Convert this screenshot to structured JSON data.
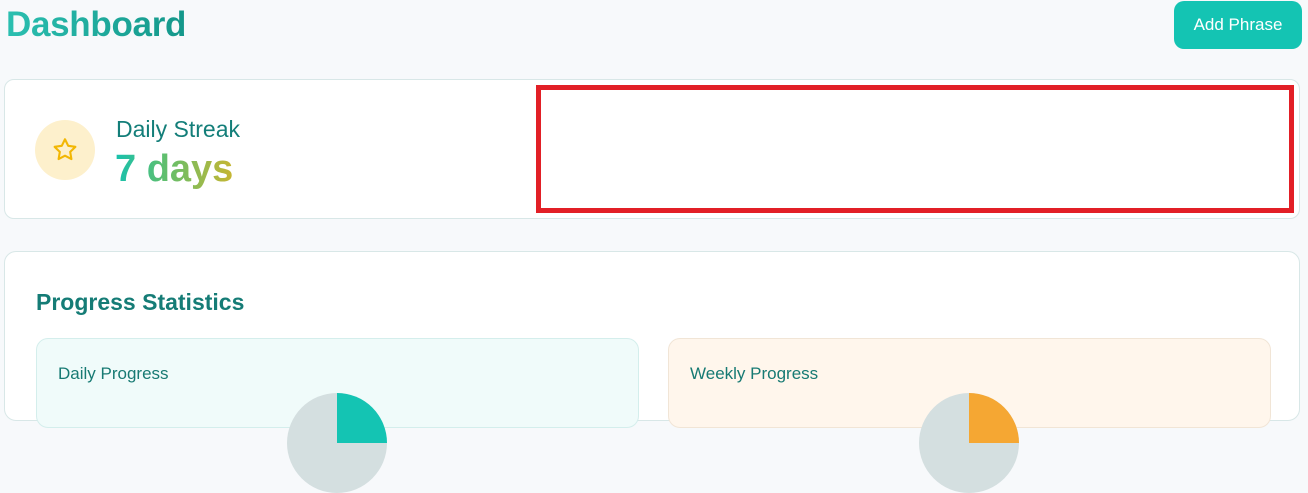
{
  "header": {
    "title": "Dashboard",
    "add_button_label": "Add Phrase"
  },
  "streak": {
    "label": "Daily Streak",
    "value": "7 days",
    "icon": "star-icon"
  },
  "stats": {
    "title": "Progress Statistics",
    "panels": [
      {
        "title": "Daily Progress",
        "accent": "#14c4b3"
      },
      {
        "title": "Weekly Progress",
        "accent": "#f5a733"
      }
    ]
  },
  "colors": {
    "brand": "#14c4b3",
    "title_dark": "#137e79",
    "highlight": "#e21f26",
    "pie_track": "#d4dfe0"
  }
}
